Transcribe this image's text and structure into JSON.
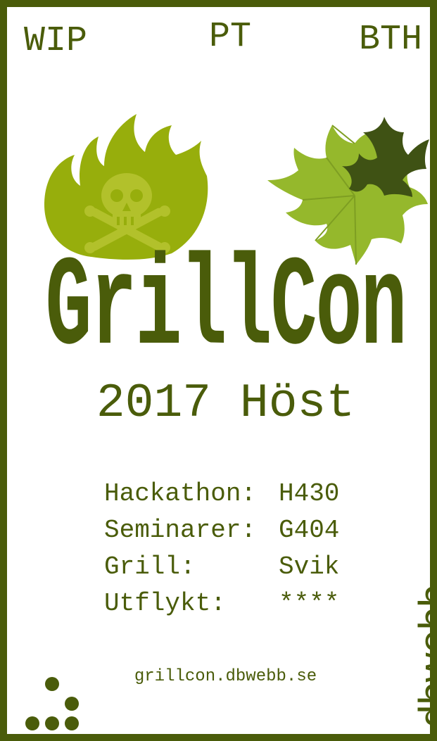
{
  "corners": {
    "left": "WIP",
    "middle": "PT",
    "right": "BTH"
  },
  "title": "GrillCon",
  "subtitle": "2017 Höst",
  "schedule": [
    {
      "label": "Hackathon:",
      "value": "H430"
    },
    {
      "label": "Seminarer:",
      "value": "G404"
    },
    {
      "label": "Grill:",
      "value": "Svik"
    },
    {
      "label": "Utflykt:",
      "value": "****"
    }
  ],
  "url": "grillcon.dbwebb.se",
  "vertical_logo": ".dbwebb",
  "colors": {
    "primary": "#4a5c0a",
    "flame": "#97ae0c",
    "skull": "#b2c12b",
    "leaf_light": "#95b82c",
    "leaf_dark": "#3f5214"
  },
  "icons": [
    "flame-skull-icon",
    "maple-leaves-icon",
    "dots-logo-icon"
  ]
}
